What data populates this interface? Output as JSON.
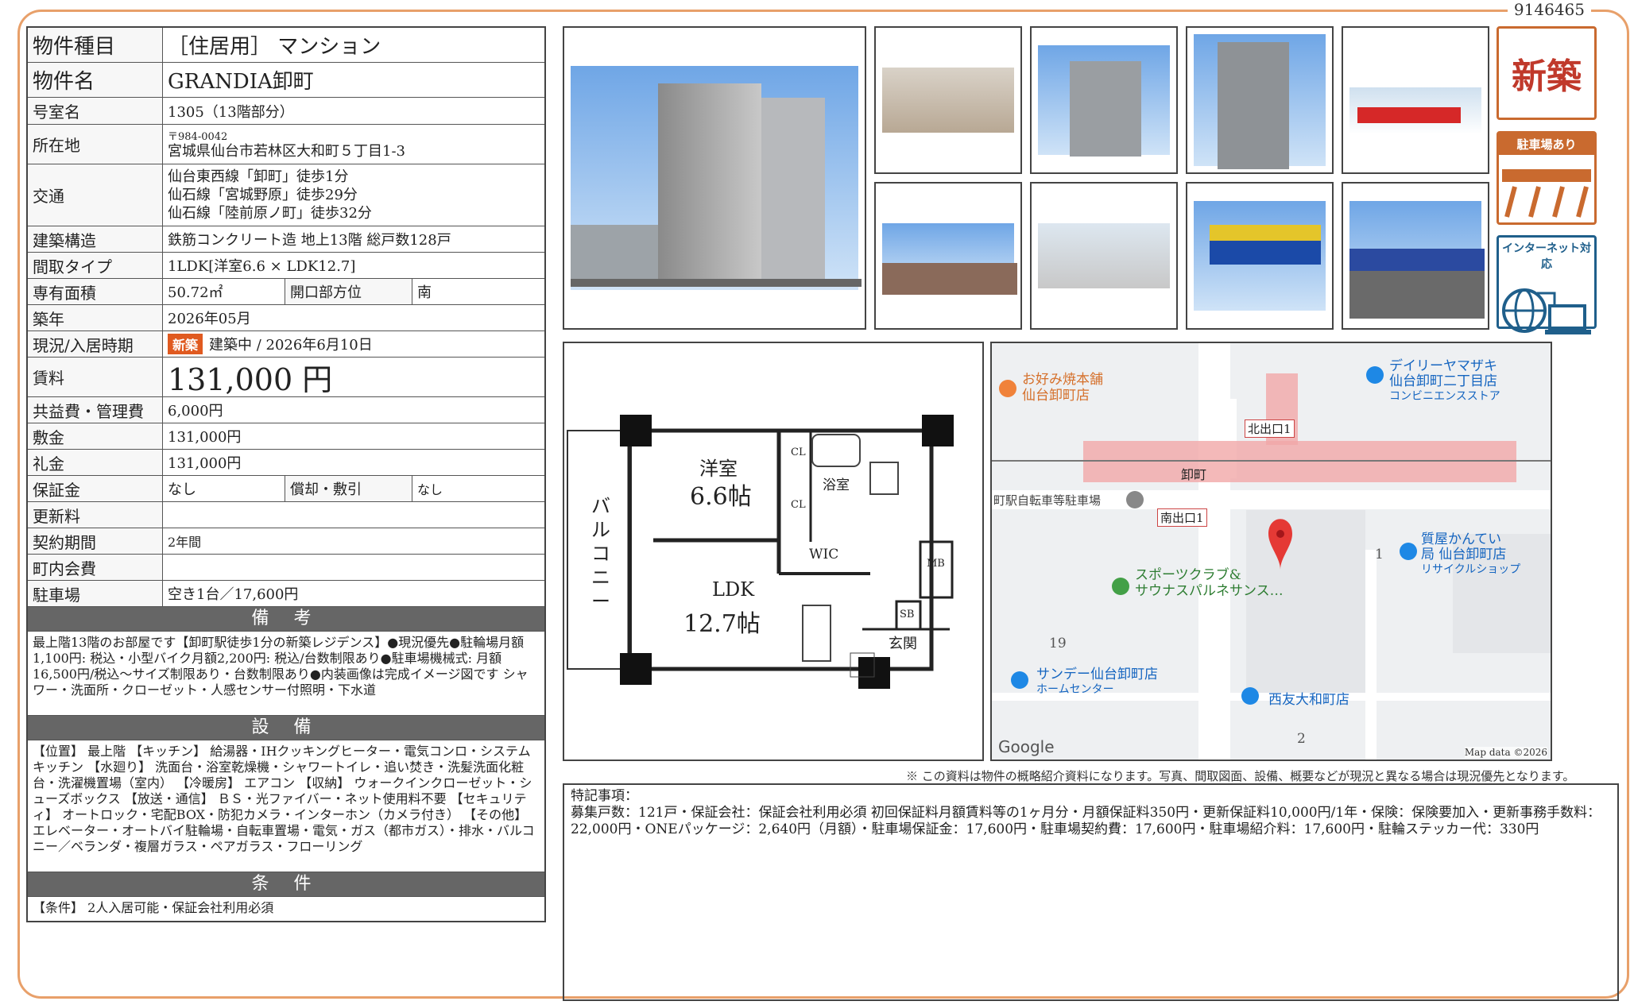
{
  "doc_id": "9146465",
  "table": {
    "type": {
      "label": "物件種目",
      "value": "［住居用］ マンション"
    },
    "name": {
      "label": "物件名",
      "value": "GRANDIA卸町"
    },
    "room": {
      "label": "号室名",
      "value": "1305（13階部分）"
    },
    "address": {
      "label": "所在地",
      "postal": "〒984-0042",
      "value": "宮城県仙台市若林区大和町５丁目1-3"
    },
    "transit": {
      "label": "交通",
      "lines": [
        "仙台東西線「卸町」徒歩1分",
        "仙石線「宮城野原」徒歩29分",
        "仙石線「陸前原ノ町」徒歩32分"
      ]
    },
    "structure": {
      "label": "建築構造",
      "value": "鉄筋コンクリート造 地上13階 総戸数128戸"
    },
    "layout": {
      "label": "間取タイプ",
      "value": "1LDK[洋室6.6 × LDK12.7]"
    },
    "area": {
      "label": "専有面積",
      "value": "50.72㎡",
      "dir_label": "開口部方位",
      "dir_value": "南"
    },
    "built": {
      "label": "築年",
      "value": "2026年05月"
    },
    "status": {
      "label": "現況/入居時期",
      "badge": "新築",
      "value": "建築中 /  2026年6月10日"
    },
    "rent": {
      "label": "賃料",
      "value": "131,000 円"
    },
    "fee": {
      "label": "共益費・管理費",
      "value": "6,000円"
    },
    "deposit": {
      "label": "敷金",
      "value": "131,000円"
    },
    "keymoney": {
      "label": "礼金",
      "value": "131,000円"
    },
    "guarantee": {
      "label": "保証金",
      "value": "なし",
      "amort_label": "償却・敷引",
      "amort_value": "なし"
    },
    "renewal": {
      "label": "更新料",
      "value": ""
    },
    "contract": {
      "label": "契約期間",
      "value": "2年間"
    },
    "community": {
      "label": "町内会費",
      "value": ""
    },
    "parking": {
      "label": "駐車場",
      "value": "空き1台／17,600円"
    }
  },
  "remarks": {
    "title": "備 考",
    "text": "最上階13階のお部屋です【卸町駅徒歩1分の新築レジデンス】●現況優先●駐輪場月額1,100円: 税込・小型バイク月額2,200円: 税込/台数制限あり●駐車場機械式: 月額16,500円/税込～サイズ制限あり・台数制限あり●内装画像は完成イメージ図です シャワー・洗面所・クローゼット・人感センサー付照明・下水道"
  },
  "equipment": {
    "title": "設 備",
    "text": "【位置】 最上階 【キッチン】 給湯器・IHクッキングヒーター・電気コンロ・システムキッチン 【水廻り】 洗面台・浴室乾燥機・シャワートイレ・追い焚き・洗髪洗面化粧台・洗濯機置場（室内） 【冷暖房】 エアコン 【収納】 ウォークインクローゼット・シューズボックス 【放送・通信】 ＢＳ・光ファイバー・ネット使用料不要 【セキュリティ】 オートロック・宅配BOX・防犯カメラ・インターホン（カメラ付き） 【その他】 エレベーター・オートバイ駐輪場・自転車置場・電気・ガス（都市ガス）・排水・バルコニー／ベランダ・複層ガラス・ペアガラス・フローリング"
  },
  "conditions": {
    "title": "条 件",
    "text": "【条件】 2人入居可能・保証会社利用必須"
  },
  "icons": {
    "new": "新築",
    "parking": "駐車場あり",
    "internet": "インターネット対応"
  },
  "floorplan": {
    "balcony": "バルコニー",
    "bedroom": "洋室",
    "bedroom_size": "6.6帖",
    "ldk": "LDK",
    "ldk_size": "12.7帖",
    "bath": "浴室",
    "cl": "CL",
    "wic": "WIC",
    "mb": "MB",
    "sb": "SB",
    "entrance": "玄関"
  },
  "map": {
    "station": "卸町",
    "exit_north": "北出口1",
    "exit_south": "南出口1",
    "okonomiyaki": [
      "お好み焼本舗",
      "仙台卸町店"
    ],
    "daily": [
      "デイリーヤマザキ",
      "仙台卸町二丁目店",
      "コンビニエンスストア"
    ],
    "bike_parking": "町駅自転車等駐車場",
    "sports": [
      "スポーツクラブ&",
      "サウナスパルネサンス…"
    ],
    "pawn": [
      "質屋かんてい",
      "局 仙台卸町店",
      "リサイクルショップ"
    ],
    "sunday": [
      "サンデー仙台卸町店",
      "ホームセンター"
    ],
    "seiyu": "西友大和町店",
    "num19": "19",
    "num1": "1",
    "num2": "2",
    "google": "Google",
    "mapdata": "Map data ©2026"
  },
  "disclaimer": "※ この資料は物件の概略紹介資料になります。写真、間取図面、設備、概要などが現況と異なる場合は現況優先となります。",
  "special": {
    "title": "特記事項：",
    "text": "募集戸数：121戸・保証会社：保証会社利用必須 初回保証料月額賃料等の1ヶ月分・月額保証料350円・更新保証料10,000円/1年・保険：保険要加入・更新事務手数料：22,000円・ONEパッケージ：2,640円（月額）・駐車場保証金：17,600円・駐車場契約費：17,600円・駐車場紹介料：17,600円・駐輪ステッカー代：330円"
  }
}
